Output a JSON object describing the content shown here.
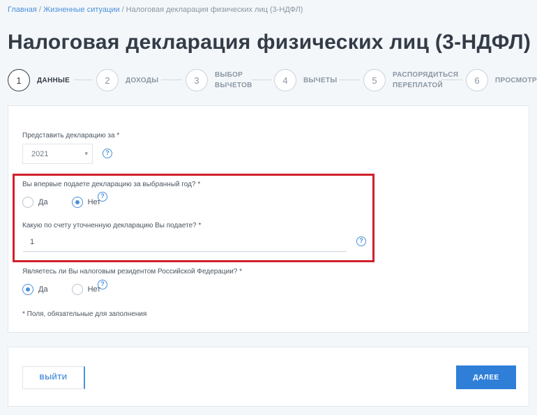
{
  "breadcrumb": {
    "items": [
      "Главная",
      "Жизненные ситуации",
      "Налоговая декларация физических лиц (3-НДФЛ)"
    ],
    "separator": "/"
  },
  "page_title": "Налоговая декларация физических лиц (3-НДФЛ)",
  "steps": [
    {
      "number": "1",
      "label": "Данные",
      "active": true
    },
    {
      "number": "2",
      "label": "Доходы",
      "active": false
    },
    {
      "number": "3",
      "label": "Выбор\nвычетов",
      "active": false
    },
    {
      "number": "4",
      "label": "Вычеты",
      "active": false
    },
    {
      "number": "5",
      "label": "Распорядиться\nпереплатой",
      "active": false
    },
    {
      "number": "6",
      "label": "Просмотр",
      "active": false
    }
  ],
  "form": {
    "year_label": "Представить декларацию за *",
    "year_value": "2021",
    "first_time_label": "Вы впервые подаете декларацию за выбранный год? *",
    "first_time_options": {
      "yes": "Да",
      "no": "Нет",
      "selected": "no"
    },
    "correction_label": "Какую по счету уточненную декларацию Вы подаете? *",
    "correction_value": "1",
    "resident_label": "Являетесь ли Вы налоговым резидентом Российской Федерации? *",
    "resident_options": {
      "yes": "Да",
      "no": "Нет",
      "selected": "yes"
    },
    "required_note": "* Поля, обязательные для заполнения",
    "info_icon_glyph": "?"
  },
  "buttons": {
    "exit": "ВЫЙТИ",
    "next": "ДАЛЕЕ"
  },
  "colors": {
    "accent": "#2f7fd8",
    "highlight": "#d0202a"
  }
}
